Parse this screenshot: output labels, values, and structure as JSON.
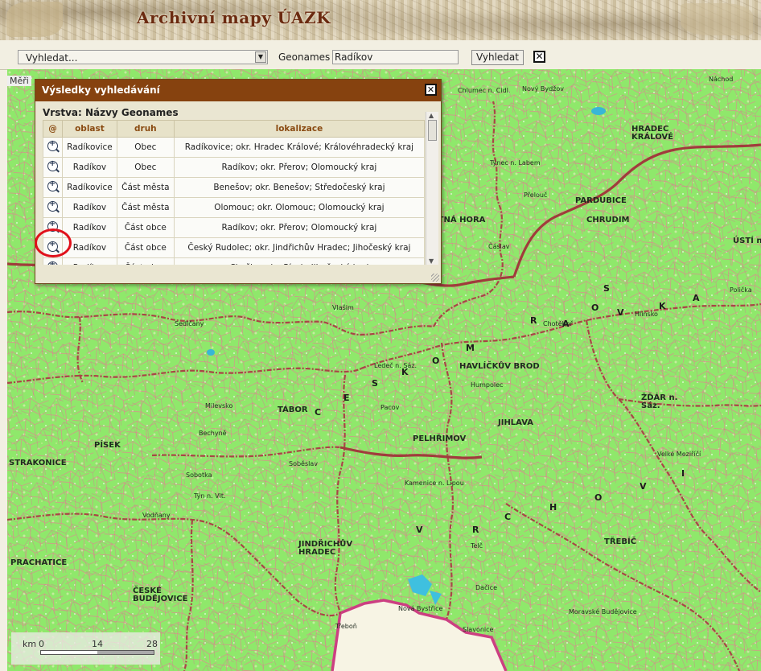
{
  "header": {
    "title": "Archivní mapy ÚAZK"
  },
  "toolbar": {
    "search_select_value": "Vyhledat...",
    "geonames_label": "Geonames",
    "geonames_value": "Radíkov",
    "search_button": "Vyhledat",
    "clear_button": "✕"
  },
  "map": {
    "meritko_label": "Měři",
    "scale": {
      "unit": "km",
      "ticks": [
        "0",
        "14",
        "28"
      ]
    },
    "region_letters": [
      {
        "text": "S"
      },
      {
        "text": "K"
      },
      {
        "text": "A"
      },
      {
        "text": "O"
      },
      {
        "text": "R"
      },
      {
        "text": "M"
      },
      {
        "text": "A"
      },
      {
        "text": "V"
      },
      {
        "text": "O"
      },
      {
        "text": "S"
      },
      {
        "text": "K"
      },
      {
        "text": "E"
      },
      {
        "text": "C"
      },
      {
        "text": "V"
      },
      {
        "text": "R"
      },
      {
        "text": "C"
      },
      {
        "text": "H"
      },
      {
        "text": "O"
      },
      {
        "text": "I"
      },
      {
        "text": "V"
      }
    ],
    "towns": [
      {
        "text": "HRADEC KRÁLOVÉ",
        "bold": true
      },
      {
        "text": "PARDUBICE",
        "bold": true
      },
      {
        "text": "CHRUDIM",
        "bold": true
      },
      {
        "text": "HAVLÍČKŮV BROD",
        "bold": true
      },
      {
        "text": "TÁBOR",
        "bold": true
      },
      {
        "text": "PELHŘIMOV",
        "bold": true
      },
      {
        "text": "JIHLAVA",
        "bold": true
      },
      {
        "text": "PÍSEK",
        "bold": true
      },
      {
        "text": "STRAKONICE",
        "bold": true
      },
      {
        "text": "PRACHATICE",
        "bold": true
      },
      {
        "text": "ČESKÉ BUDĚJOVICE",
        "bold": true
      },
      {
        "text": "JINDŘICHŮV HRADEC",
        "bold": true
      },
      {
        "text": "TŘEBÍČ",
        "bold": true
      },
      {
        "text": "ŽĎÁR n. Sáz.",
        "bold": true
      },
      {
        "text": "ÚSTÍ n.",
        "bold": true
      },
      {
        "text": "KUTNÁ HORA",
        "bold": true
      },
      {
        "text": "Náchod",
        "bold": false
      },
      {
        "text": "Nový Bydžov",
        "bold": false
      },
      {
        "text": "Chlumec n. Cidl.",
        "bold": false
      },
      {
        "text": "Týnec n. Labem",
        "bold": false
      },
      {
        "text": "Přelouč",
        "bold": false
      },
      {
        "text": "Čáslav",
        "bold": false
      },
      {
        "text": "Humpolec",
        "bold": false
      },
      {
        "text": "Pacov",
        "bold": false
      },
      {
        "text": "Vlašim",
        "bold": false
      },
      {
        "text": "Sedlčany",
        "bold": false
      },
      {
        "text": "Milevsko",
        "bold": false
      },
      {
        "text": "Sobotka",
        "bold": false
      },
      {
        "text": "Vodňany",
        "bold": false
      },
      {
        "text": "Třeboň",
        "bold": false
      },
      {
        "text": "Telč",
        "bold": false
      },
      {
        "text": "Dačice",
        "bold": false
      },
      {
        "text": "Moravské Budějovice",
        "bold": false
      },
      {
        "text": "Velké Meziříčí",
        "bold": false
      },
      {
        "text": "Polička",
        "bold": false
      },
      {
        "text": "Hlinsko",
        "bold": false
      },
      {
        "text": "Chotěboř",
        "bold": false
      },
      {
        "text": "Ledeč n. Sáz.",
        "bold": false
      },
      {
        "text": "Kamenice n. Lipou",
        "bold": false
      },
      {
        "text": "Soběslav",
        "bold": false
      },
      {
        "text": "Bechyně",
        "bold": false
      },
      {
        "text": "Týn n. Vlt.",
        "bold": false
      },
      {
        "text": "Nová Bystřice",
        "bold": false
      },
      {
        "text": "Slavonice",
        "bold": false
      }
    ]
  },
  "dialog": {
    "title": "Výsledky vyhledávání",
    "layer": "Vrstva: Názvy Geonames",
    "columns": [
      "@",
      "oblast",
      "druh",
      "lokalizace"
    ],
    "rows": [
      {
        "oblast": "Radíkovice",
        "druh": "Obec",
        "lokalizace": "Radíkovice; okr. Hradec Králové; Královéhradecký kraj"
      },
      {
        "oblast": "Radíkov",
        "druh": "Obec",
        "lokalizace": "Radíkov; okr. Přerov; Olomoucký kraj"
      },
      {
        "oblast": "Radíkovice",
        "druh": "Část města",
        "lokalizace": "Benešov; okr. Benešov; Středočeský kraj"
      },
      {
        "oblast": "Radíkov",
        "druh": "Část města",
        "lokalizace": "Olomouc; okr. Olomouc; Olomoucký kraj"
      },
      {
        "oblast": "Radíkov",
        "druh": "Část obce",
        "lokalizace": "Radíkov; okr. Přerov; Olomoucký kraj"
      },
      {
        "oblast": "Radíkov",
        "druh": "Část obce",
        "lokalizace": "Český Rudolec; okr. Jindřichův Hradec; Jihočeský kraj"
      },
      {
        "oblast": "Radíkov",
        "druh": "Část obce",
        "lokalizace": "Chyšky; okr. Písek; Jihočeský kraj"
      }
    ]
  }
}
